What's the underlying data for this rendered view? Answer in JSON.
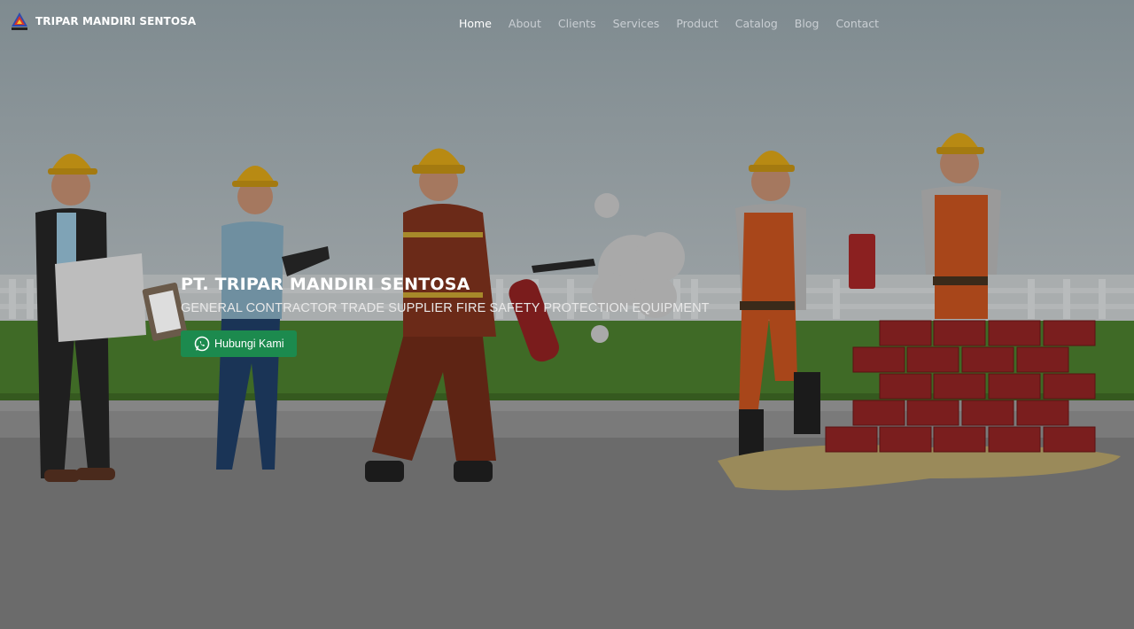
{
  "header": {
    "brand_name": "TRIPAR MANDIRI SENTOSA",
    "logo_icon": "triangle-logo-icon"
  },
  "nav": {
    "items": [
      {
        "label": "Home",
        "active": true
      },
      {
        "label": "About",
        "active": false
      },
      {
        "label": "Clients",
        "active": false
      },
      {
        "label": "Services",
        "active": false
      },
      {
        "label": "Product",
        "active": false
      },
      {
        "label": "Catalog",
        "active": false
      },
      {
        "label": "Blog",
        "active": false
      },
      {
        "label": "Contact",
        "active": false
      }
    ]
  },
  "hero": {
    "title": "PT. TRIPAR MANDIRI SENTOSA",
    "subtitle": "GENERAL CONTRACTOR TRADE SUPPLIER FIRE SAFETY PROTECTION EQUIPMENT",
    "cta_label": "Hubungi Kami",
    "cta_icon": "whatsapp-icon",
    "cta_color": "#1c8a4e"
  }
}
